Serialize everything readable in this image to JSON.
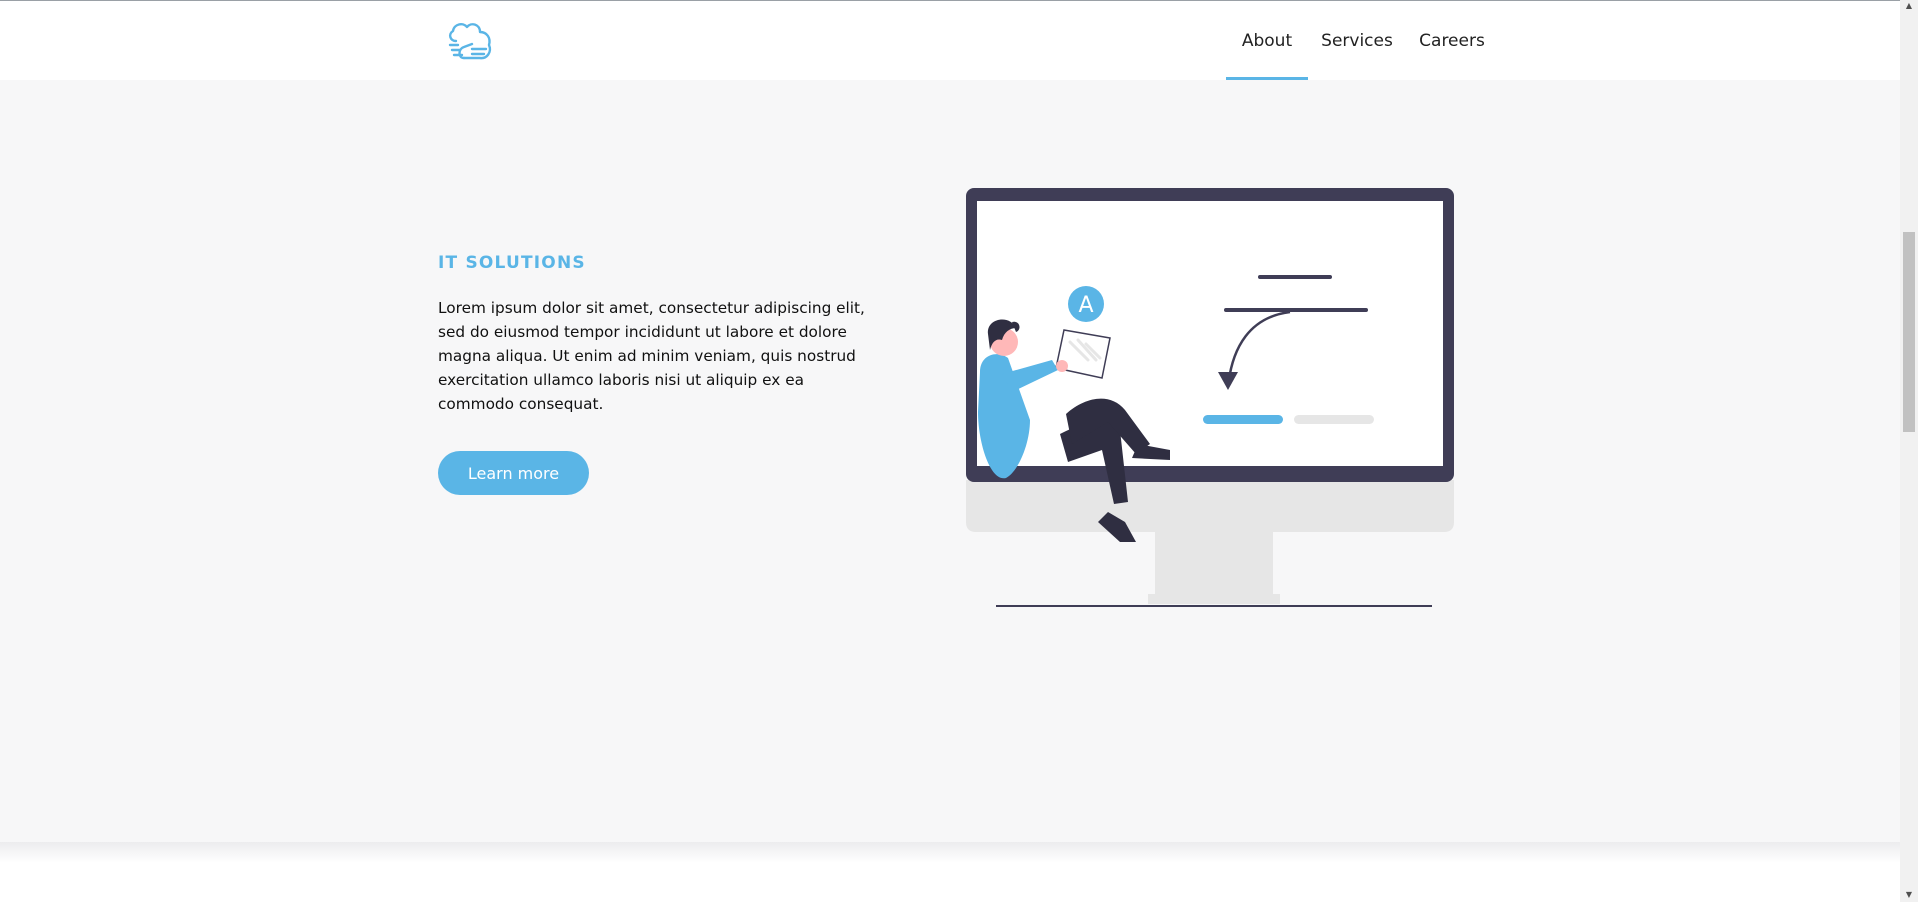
{
  "header": {
    "logo_icon": "cloud-hand-logo",
    "nav": [
      {
        "label": "About",
        "active": true
      },
      {
        "label": "Services",
        "active": false
      },
      {
        "label": "Careers",
        "active": false
      }
    ]
  },
  "hero": {
    "eyebrow": "IT SOLUTIONS",
    "paragraph": "Lorem ipsum dolor sit amet, consectetur adipiscing elit, sed do eiusmod tempor incididunt ut labore et dolore magna aliqua. Ut enim ad minim veniam, quis nostrud exercitation ullamco laboris nisi ut aliquip ex ea commodo consequat.",
    "cta_label": "Learn more",
    "illustration_badge": "A"
  },
  "colors": {
    "accent": "#5ab5e6",
    "dark": "#3f3d56",
    "background": "#f7f7f8"
  }
}
